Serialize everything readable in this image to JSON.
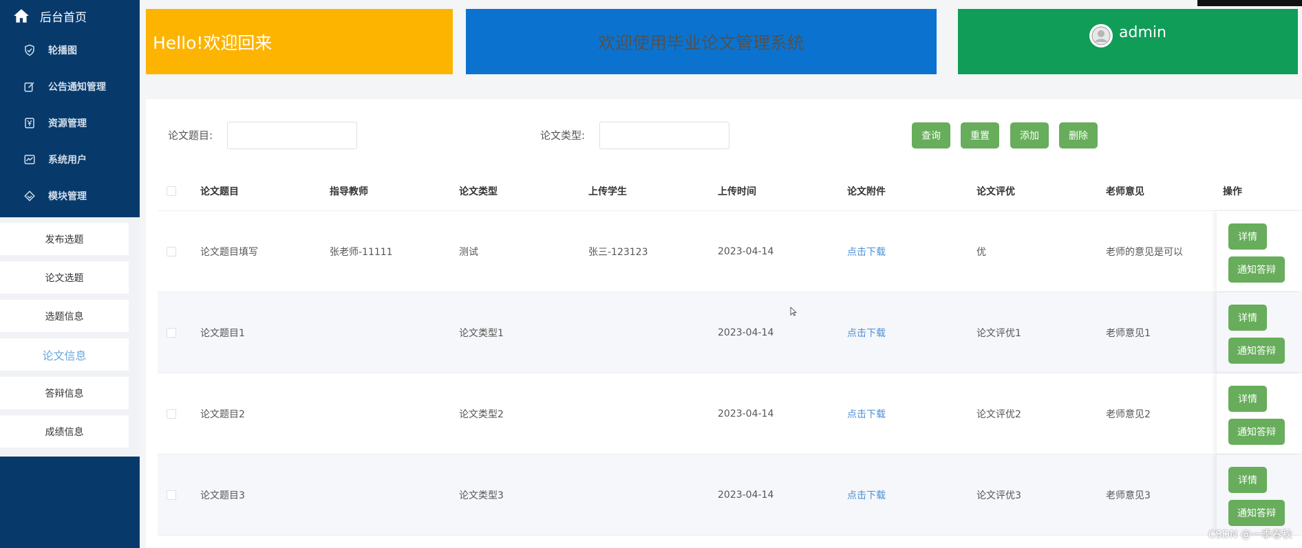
{
  "sidebar": {
    "home_label": "后台首页",
    "items": [
      {
        "label": "轮播图",
        "icon": "shield-icon"
      },
      {
        "label": "公告通知管理",
        "icon": "edit-icon"
      },
      {
        "label": "资源管理",
        "icon": "yen-icon"
      },
      {
        "label": "系统用户",
        "icon": "chart-icon"
      },
      {
        "label": "模块管理",
        "icon": "diamond-icon"
      }
    ],
    "submenu": [
      {
        "label": "发布选题"
      },
      {
        "label": "论文选题"
      },
      {
        "label": "选题信息"
      },
      {
        "label": "论文信息",
        "active": true
      },
      {
        "label": "答辩信息"
      },
      {
        "label": "成绩信息"
      }
    ]
  },
  "cards": {
    "hello": "Hello!欢迎回来",
    "welcome": "欢迎使用毕业论文管理系统",
    "user": "admin"
  },
  "search": {
    "title_label": "论文题目:",
    "title_value": "",
    "type_label": "论文类型:",
    "type_value": "",
    "buttons": {
      "query": "查询",
      "reset": "重置",
      "add": "添加",
      "delete": "删除"
    }
  },
  "table": {
    "columns": [
      "论文题目",
      "指导教师",
      "论文类型",
      "上传学生",
      "上传时间",
      "论文附件",
      "论文评优",
      "老师意见",
      "操作"
    ],
    "rows": [
      [
        "论文题目填写",
        "张老师-11111",
        "测试",
        "张三-123123",
        "2023-04-14",
        "点击下载",
        "优",
        "老师的意见是可以"
      ],
      [
        "论文题目1",
        "",
        "论文类型1",
        "",
        "2023-04-14",
        "点击下载",
        "论文评优1",
        "老师意见1"
      ],
      [
        "论文题目2",
        "",
        "论文类型2",
        "",
        "2023-04-14",
        "点击下载",
        "论文评优2",
        "老师意见2"
      ],
      [
        "论文题目3",
        "",
        "论文类型3",
        "",
        "2023-04-14",
        "点击下载",
        "论文评优3",
        "老师意见3"
      ]
    ],
    "op_detail": "详情",
    "op_notify": "通知答辩"
  },
  "watermark": "CSDN @一季春秋",
  "colors": {
    "sidebar": "#073a6b",
    "hello": "#fdb400",
    "welcome": "#0b73cf",
    "user": "#0f9d58",
    "button": "#67ad5b",
    "link": "#4a8fd6"
  }
}
